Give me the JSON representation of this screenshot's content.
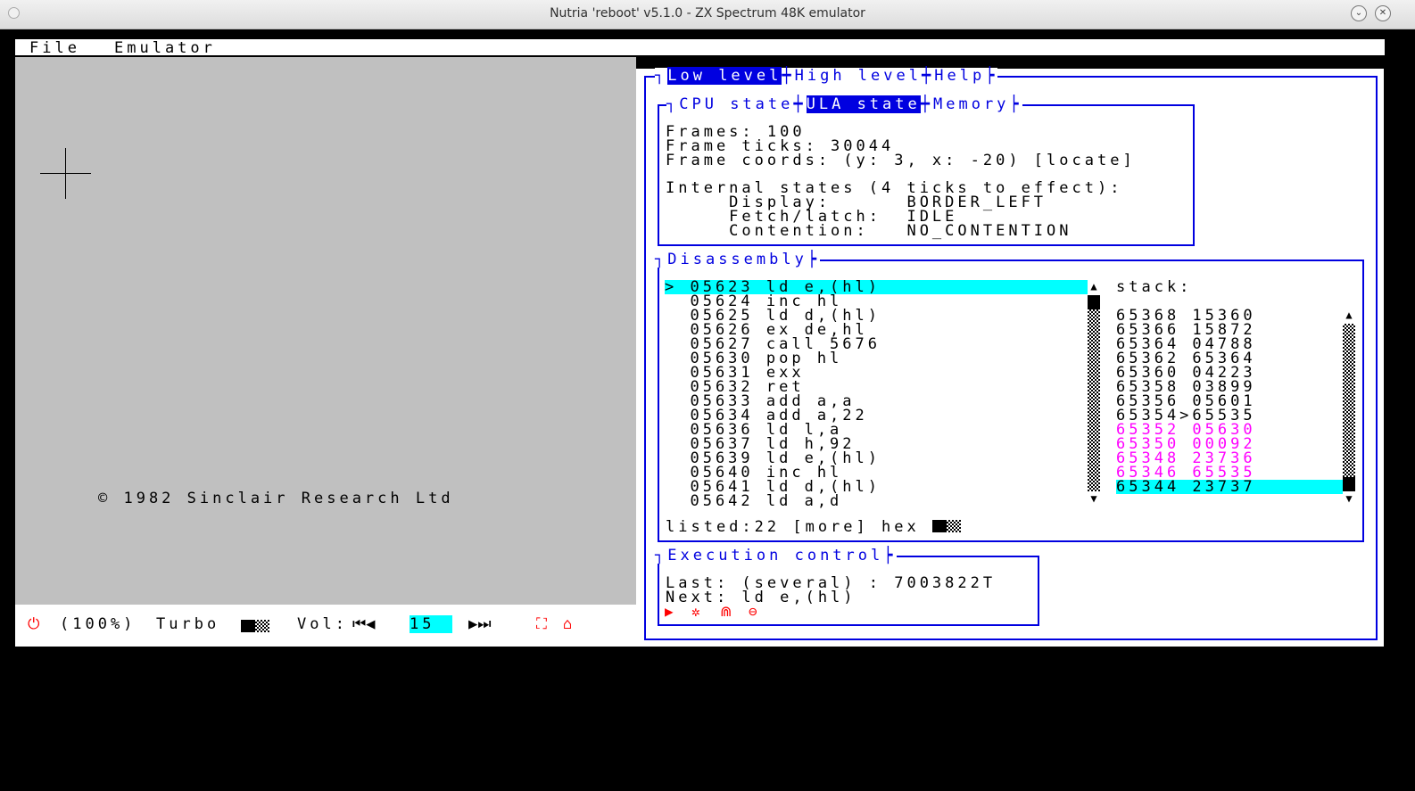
{
  "window": {
    "title": "Nutria 'reboot' v5.1.0 - ZX Spectrum 48K emulator"
  },
  "menu": {
    "file": "File",
    "emulator": "Emulator"
  },
  "screen": {
    "copyright": "© 1982 Sinclair Research Ltd"
  },
  "status": {
    "zoom": "(100%)",
    "turbo": "Turbo",
    "vol_label": "Vol:",
    "volume": "15",
    "vol_down": "⏮◀",
    "vol_up": "▶⏭"
  },
  "tabs": {
    "low": "Low level",
    "high": "High level",
    "help": "Help"
  },
  "subtabs": {
    "cpu": "CPU state",
    "ula": "ULA state",
    "memory": "Memory"
  },
  "ula": {
    "frames": "Frames: 100",
    "ticks": "Frame ticks: 30044",
    "coords": "Frame coords: (y: 3, x: -20) [locate]",
    "internal": "Internal states (4 ticks to effect):",
    "display": "     Display:      BORDER_LEFT",
    "fetch": "     Fetch/latch:  IDLE",
    "contention": "     Contention:   NO_CONTENTION"
  },
  "disasm": {
    "title": "Disassembly",
    "rows": [
      "> 05623 ld e,(hl)",
      "  05624 inc hl",
      "  05625 ld d,(hl)",
      "  05626 ex de,hl",
      "  05627 call 5676",
      "  05630 pop hl",
      "  05631 exx",
      "  05632 ret",
      "  05633 add a,a",
      "  05634 add a,22",
      "  05636 ld l,a",
      "  05637 ld h,92",
      "  05639 ld e,(hl)",
      "  05640 inc hl",
      "  05641 ld d,(hl)",
      "  05642 ld a,d"
    ],
    "stack_label": "stack:",
    "stack": [
      "65368 15360",
      "65366 15872",
      "65364 04788",
      "65362 65364",
      "65360 04223",
      "65358 03899",
      "65356 05601",
      "65354>65535",
      "65352 05630",
      "65350 00092",
      "65348 23736",
      "65346 65535",
      "65344 23737"
    ],
    "footer": "listed:22 [more] hex"
  },
  "exec": {
    "title": "Execution control",
    "last": "Last: (several) : 7003822T",
    "next": "Next: ld e,(hl)"
  },
  "colors": {
    "blue": "#0000e0",
    "cyan": "#00ffff",
    "magenta": "#ff00ff",
    "red": "#ff0000",
    "screen": "#c0c0c0"
  }
}
